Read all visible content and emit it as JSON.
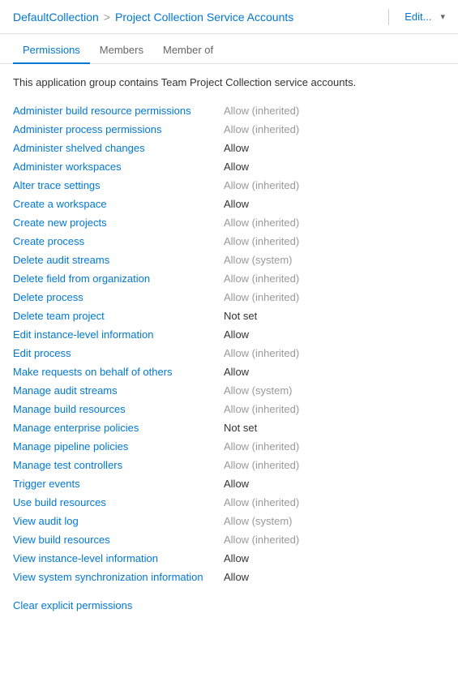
{
  "header": {
    "collection": "DefaultCollection",
    "separator": ">",
    "current": "Project Collection Service Accounts",
    "edit_label": "Edit...",
    "chevron": "▾"
  },
  "tabs": [
    {
      "id": "permissions",
      "label": "Permissions",
      "active": true
    },
    {
      "id": "members",
      "label": "Members",
      "active": false
    },
    {
      "id": "member-of",
      "label": "Member of",
      "active": false
    }
  ],
  "description": "This application group contains Team Project Collection service accounts.",
  "permissions": [
    {
      "name": "Administer build resource permissions",
      "value": "Allow (inherited)",
      "type": "inherited"
    },
    {
      "name": "Administer process permissions",
      "value": "Allow (inherited)",
      "type": "inherited"
    },
    {
      "name": "Administer shelved changes",
      "value": "Allow",
      "type": "allow"
    },
    {
      "name": "Administer workspaces",
      "value": "Allow",
      "type": "allow"
    },
    {
      "name": "Alter trace settings",
      "value": "Allow (inherited)",
      "type": "inherited"
    },
    {
      "name": "Create a workspace",
      "value": "Allow",
      "type": "allow"
    },
    {
      "name": "Create new projects",
      "value": "Allow (inherited)",
      "type": "inherited"
    },
    {
      "name": "Create process",
      "value": "Allow (inherited)",
      "type": "inherited"
    },
    {
      "name": "Delete audit streams",
      "value": "Allow (system)",
      "type": "system"
    },
    {
      "name": "Delete field from organization",
      "value": "Allow (inherited)",
      "type": "inherited"
    },
    {
      "name": "Delete process",
      "value": "Allow (inherited)",
      "type": "inherited"
    },
    {
      "name": "Delete team project",
      "value": "Not set",
      "type": "not-set"
    },
    {
      "name": "Edit instance-level information",
      "value": "Allow",
      "type": "allow"
    },
    {
      "name": "Edit process",
      "value": "Allow (inherited)",
      "type": "inherited"
    },
    {
      "name": "Make requests on behalf of others",
      "value": "Allow",
      "type": "allow"
    },
    {
      "name": "Manage audit streams",
      "value": "Allow (system)",
      "type": "system"
    },
    {
      "name": "Manage build resources",
      "value": "Allow (inherited)",
      "type": "inherited"
    },
    {
      "name": "Manage enterprise policies",
      "value": "Not set",
      "type": "not-set"
    },
    {
      "name": "Manage pipeline policies",
      "value": "Allow (inherited)",
      "type": "inherited"
    },
    {
      "name": "Manage test controllers",
      "value": "Allow (inherited)",
      "type": "inherited"
    },
    {
      "name": "Trigger events",
      "value": "Allow",
      "type": "allow"
    },
    {
      "name": "Use build resources",
      "value": "Allow (inherited)",
      "type": "inherited"
    },
    {
      "name": "View audit log",
      "value": "Allow (system)",
      "type": "system"
    },
    {
      "name": "View build resources",
      "value": "Allow (inherited)",
      "type": "inherited"
    },
    {
      "name": "View instance-level information",
      "value": "Allow",
      "type": "allow"
    },
    {
      "name": "View system synchronization information",
      "value": "Allow",
      "type": "allow"
    }
  ],
  "clear_link_label": "Clear explicit permissions"
}
